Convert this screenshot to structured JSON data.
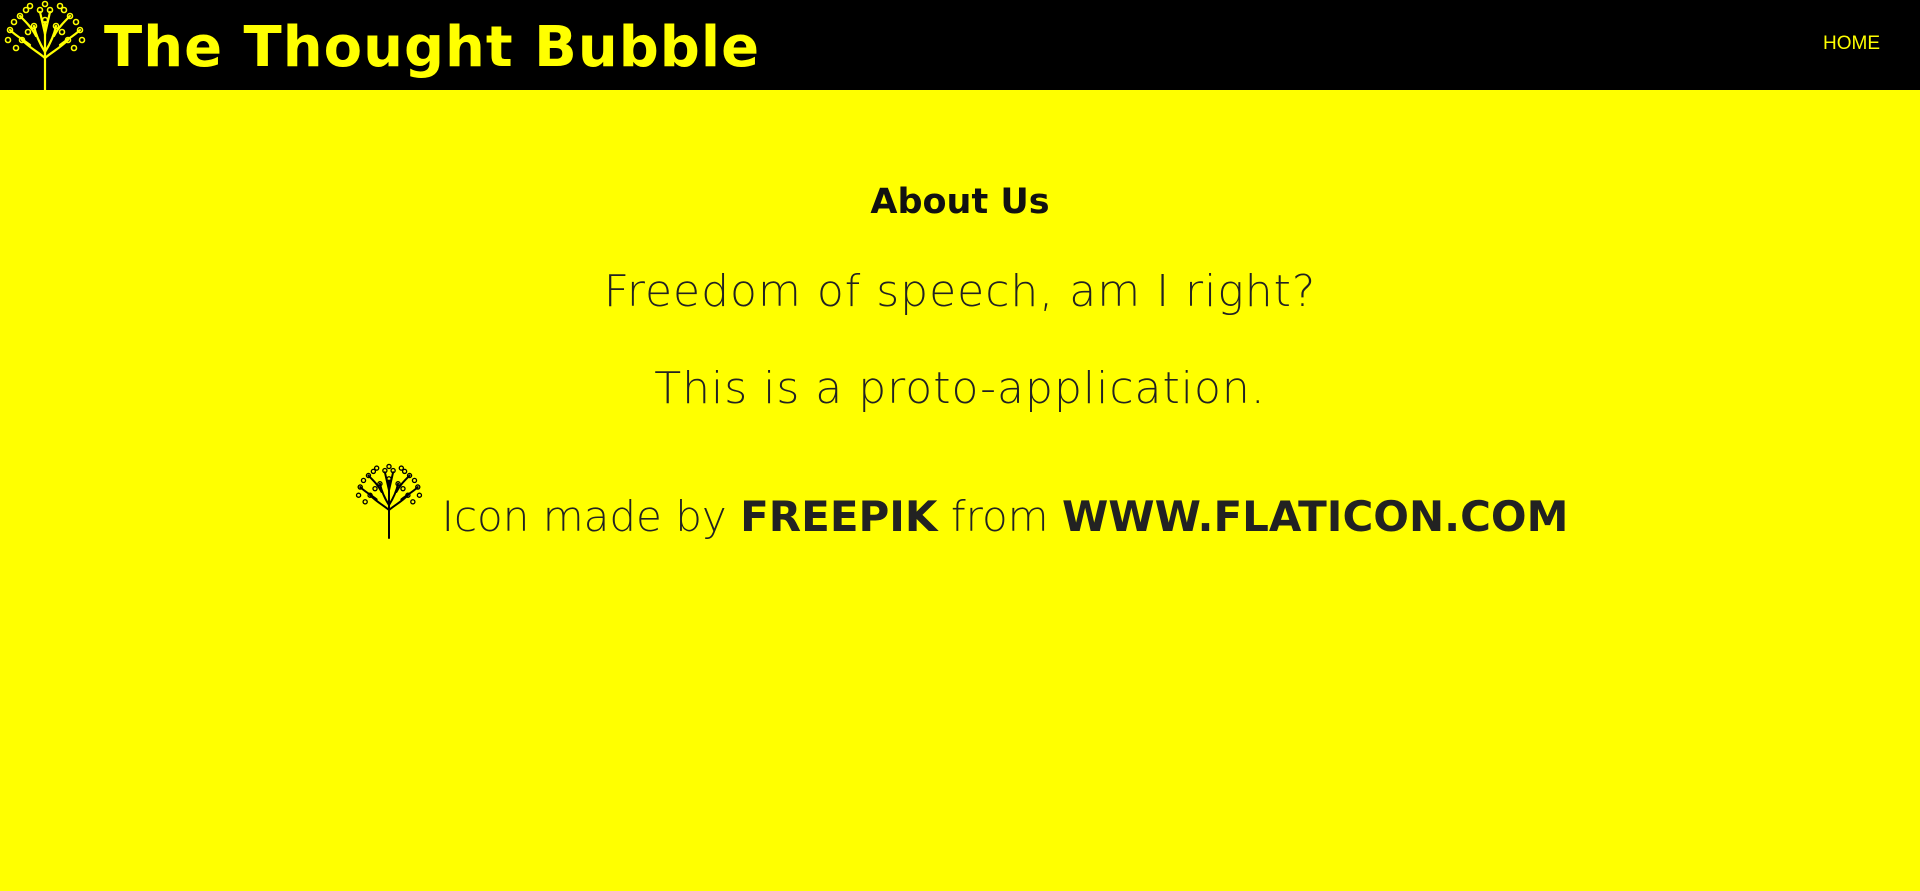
{
  "navbar": {
    "brand_title": "The Thought Bubble",
    "logo_icon": "tree-icon",
    "home_link": "HOME",
    "background": "#000000",
    "accent": "#ffff00"
  },
  "main": {
    "heading": "About Us",
    "paragraphs": [
      "Freedom of speech, am I right?",
      "This is a proto-application."
    ],
    "credit": {
      "icon": "tree-icon",
      "prefix": "Icon made by",
      "author": "FREEPIK",
      "middle": "from",
      "site": "WWW.FLATICON.COM"
    },
    "background": "#ffff00"
  }
}
